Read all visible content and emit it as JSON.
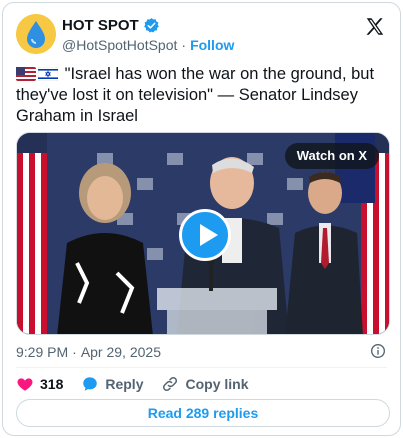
{
  "account": {
    "name": "HOT SPOT",
    "handle": "@HotSpotHotSpot",
    "separator": "·",
    "follow_label": "Follow",
    "avatar_icon": "water-drop-icon",
    "verified_icon": "verified-badge-icon"
  },
  "tweet": {
    "flags": [
      "us-flag-icon",
      "israel-flag-icon"
    ],
    "text": "\"Israel has won the war on the ground, but they've lost it on television\" — Senator Lindsey Graham in Israel"
  },
  "media": {
    "watch_label": "Watch on X",
    "play_icon": "play-icon"
  },
  "meta": {
    "time": "9:29 PM",
    "separator": "·",
    "date": "Apr 29, 2025"
  },
  "actions": {
    "like_count": "318",
    "reply_label": "Reply",
    "copy_link_label": "Copy link"
  },
  "footer": {
    "read_replies_label": "Read 289 replies"
  },
  "colors": {
    "accent": "#1d9bf0",
    "like": "#f91880",
    "text": "#0f1419",
    "secondary": "#536471"
  }
}
